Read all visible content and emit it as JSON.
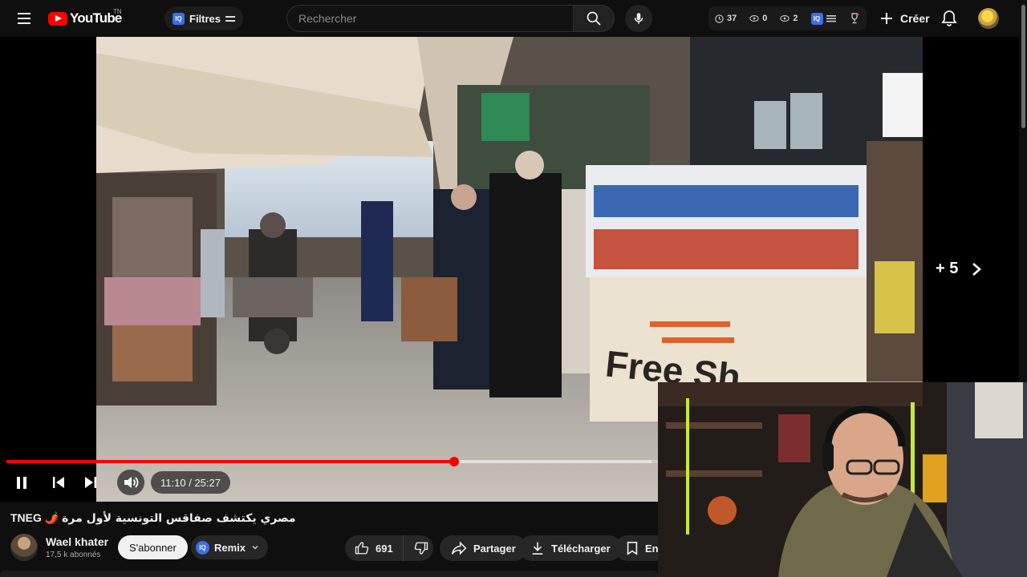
{
  "header": {
    "menu_icon": "hamburger-icon",
    "logo_text": "YouTube",
    "logo_country": "TN",
    "filters_badge": "IQ",
    "filters_label": "Filtres",
    "search_placeholder": "Rechercher",
    "stats": {
      "watch": "37",
      "views": "0",
      "hidden": "2"
    },
    "stats_badge": "IQ",
    "create_label": "Créer",
    "accent_color": "#ff0000"
  },
  "player": {
    "next_videos_label": "+ 5",
    "time_current": "11:10",
    "time_separator": "/",
    "time_total": "25:27",
    "progress_fraction": 0.6876,
    "buffer_fraction": 0.99,
    "scene_sign_text": "Free Sh",
    "state": "playing"
  },
  "video": {
    "title_prefix": "TNEG",
    "title_emoji": "🌶️",
    "title_arabic": "مصري يكتشف صفاقس التونسية لأول مرة",
    "channel_name": "Wael khater",
    "subscribers": "17,5 k abonnés",
    "subscribe_label": "S'abonner",
    "remix_badge": "IQ",
    "remix_label": "Remix",
    "likes": "691",
    "share_label": "Partager",
    "download_label": "Télécharger",
    "save_label": "Enre"
  }
}
